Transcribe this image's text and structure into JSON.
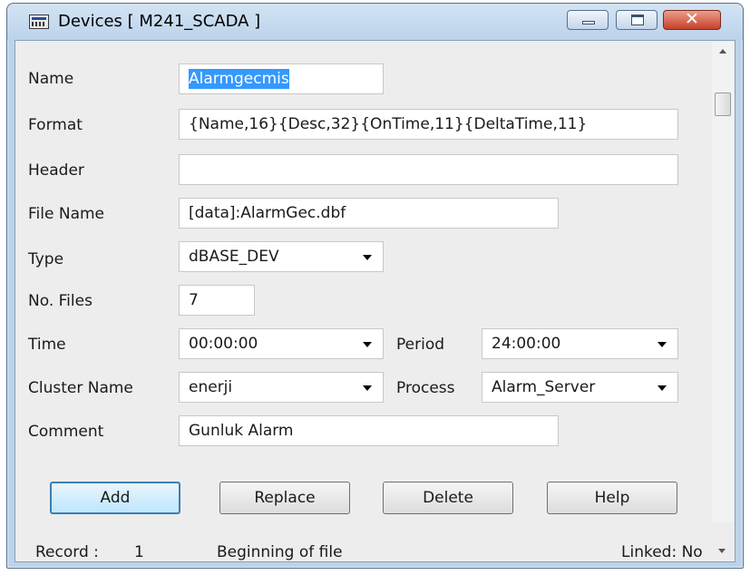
{
  "window": {
    "title": "Devices [ M241_SCADA ]",
    "icons": {
      "app": "window-app-icon",
      "minimize": "minimize-icon",
      "maximize": "maximize-icon",
      "close": "close-icon"
    },
    "close_glyph": "✕"
  },
  "form": {
    "name": {
      "label": "Name",
      "value": "Alarmgecmis"
    },
    "format": {
      "label": "Format",
      "value": "{Name,16}{Desc,32}{OnTime,11}{DeltaTime,11}"
    },
    "header": {
      "label": "Header",
      "value": ""
    },
    "file_name": {
      "label": "File Name",
      "value": "[data]:AlarmGec.dbf"
    },
    "type": {
      "label": "Type",
      "value": "dBASE_DEV"
    },
    "no_files": {
      "label": "No. Files",
      "value": "7"
    },
    "time": {
      "label": "Time",
      "value": "00:00:00"
    },
    "period": {
      "label": "Period",
      "value": "24:00:00"
    },
    "cluster_name": {
      "label": "Cluster Name",
      "value": "enerji"
    },
    "process": {
      "label": "Process",
      "value": "Alarm_Server"
    },
    "comment": {
      "label": "Comment",
      "value": "Gunluk Alarm"
    }
  },
  "buttons": {
    "add": "Add",
    "replace": "Replace",
    "delete": "Delete",
    "help": "Help"
  },
  "status": {
    "record_label": "Record :",
    "record_value": "1",
    "position": "Beginning of file",
    "linked": "Linked: No"
  },
  "colors": {
    "title_bar": "#bcd3ea",
    "selection": "#3399ff",
    "close_button": "#c7402a"
  }
}
